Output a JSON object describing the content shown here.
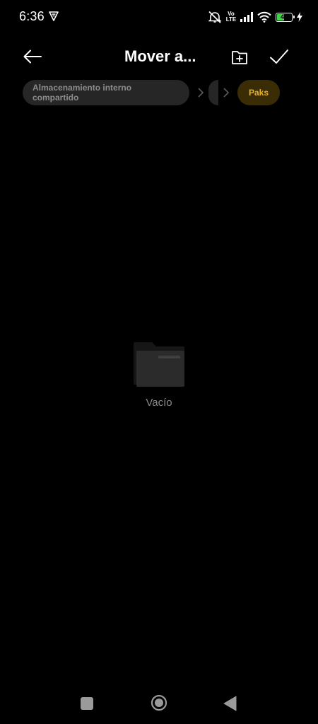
{
  "status_bar": {
    "time": "6:36",
    "volte_top": "Vo",
    "volte_bottom": "LTE",
    "battery_level": "49",
    "battery_fraction": 0.49,
    "icons": [
      "vpn-icon",
      "mute-icon",
      "volte-icon",
      "signal-icon",
      "wifi-icon",
      "battery-icon",
      "charging-icon"
    ]
  },
  "header": {
    "title": "Mover a..."
  },
  "breadcrumb": {
    "items": [
      {
        "label": "Almacenamiento interno compartido"
      },
      {
        "label": ""
      },
      {
        "label": "Paks"
      }
    ]
  },
  "empty_state": {
    "label": "Vacío"
  },
  "colors": {
    "background": "#000000",
    "accent": "#e8b423",
    "accent_bg": "#3a2d05",
    "chip_bg": "#262626",
    "muted_text": "#8c8c8c"
  }
}
